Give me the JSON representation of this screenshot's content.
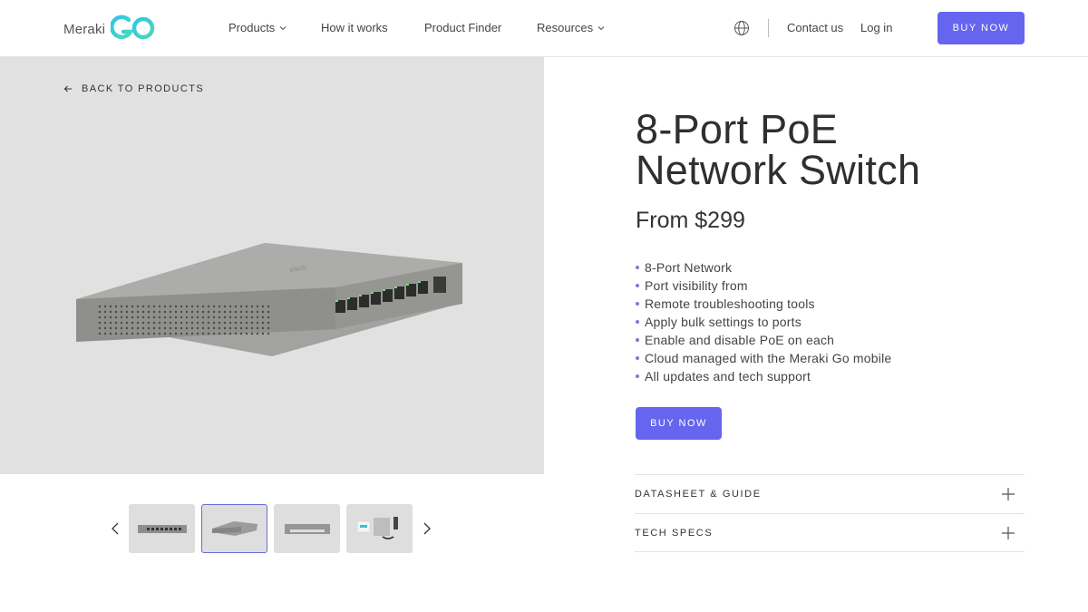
{
  "header": {
    "logo_text": "Meraki",
    "nav": [
      {
        "label": "Products",
        "has_dropdown": true
      },
      {
        "label": "How it works",
        "has_dropdown": false
      },
      {
        "label": "Product Finder",
        "has_dropdown": false
      },
      {
        "label": "Resources",
        "has_dropdown": true
      }
    ],
    "globe_icon": "globe-icon",
    "contact_label": "Contact us",
    "login_label": "Log in",
    "buy_label": "BUY NOW"
  },
  "gallery": {
    "back_label": "BACK TO PRODUCTS",
    "thumbnail_count": 4,
    "active_thumbnail": 2
  },
  "product": {
    "title_line1": "8-Port PoE",
    "title_line2": "Network Switch",
    "price": "From $299",
    "features": [
      "8-Port Network",
      "Port visibility from",
      "Remote troubleshooting tools",
      "Apply bulk settings to ports",
      "Enable and disable PoE on each",
      "Cloud managed with the Meraki Go mobile",
      "All updates and tech support"
    ],
    "buy_label": "BUY NOW"
  },
  "accordions": [
    {
      "label": "DATASHEET & GUIDE"
    },
    {
      "label": "TECH SPECS"
    }
  ],
  "colors": {
    "accent": "#6565f0",
    "hero_bg": "#e1e1e1"
  }
}
